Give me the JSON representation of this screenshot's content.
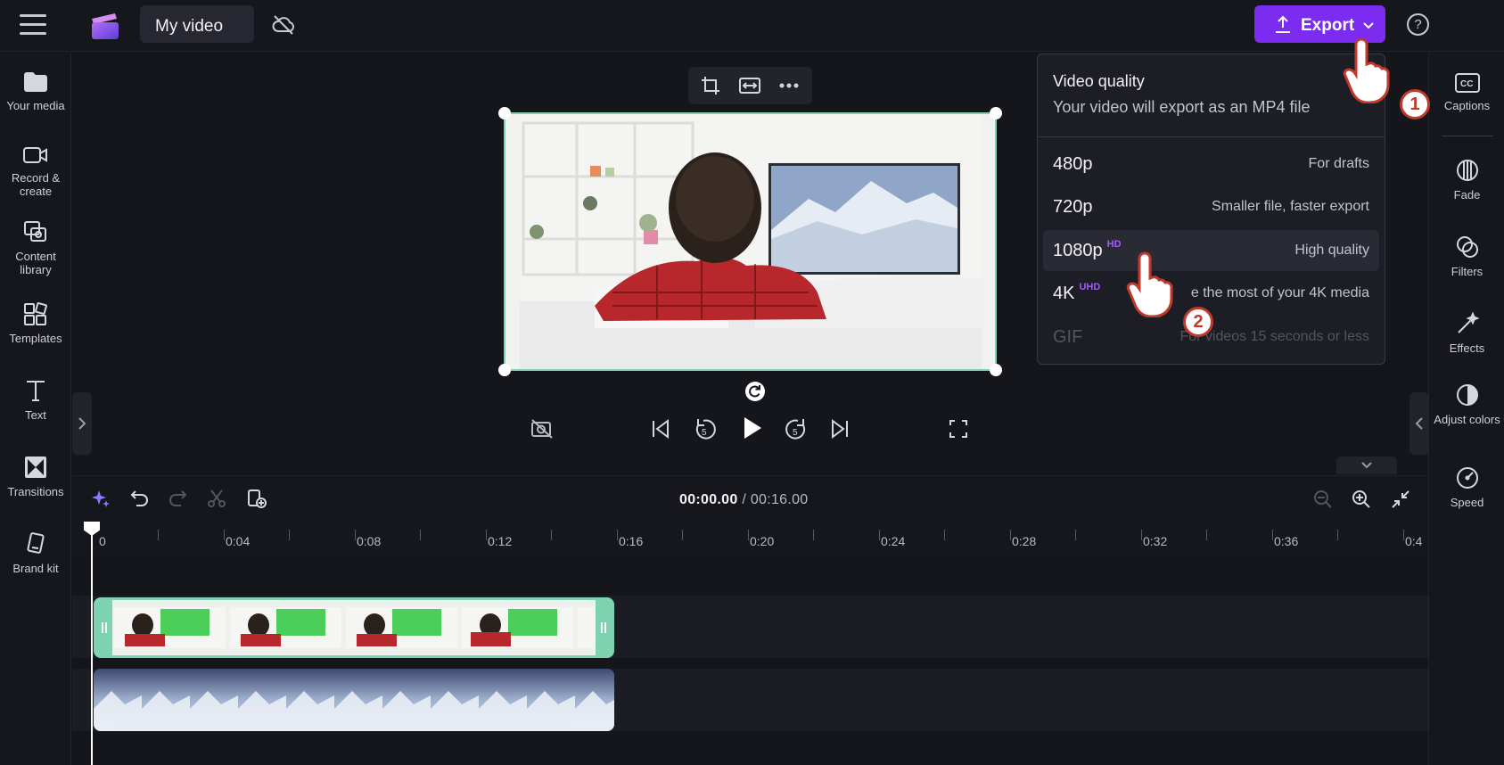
{
  "header": {
    "project_title": "My video",
    "export_label": "Export",
    "help_label": "?"
  },
  "left_sidebar": {
    "items": [
      {
        "label": "Your media",
        "icon": "folder-icon"
      },
      {
        "label": "Record & create",
        "icon": "camera-icon"
      },
      {
        "label": "Content library",
        "icon": "library-icon"
      },
      {
        "label": "Templates",
        "icon": "templates-icon"
      },
      {
        "label": "Text",
        "icon": "text-icon"
      },
      {
        "label": "Transitions",
        "icon": "transitions-icon"
      },
      {
        "label": "Brand kit",
        "icon": "brand-kit-icon"
      }
    ]
  },
  "right_sidebar": {
    "items": [
      {
        "label": "Captions",
        "icon": "cc-icon"
      },
      {
        "label": "Fade",
        "icon": "fade-icon"
      },
      {
        "label": "Filters",
        "icon": "filters-icon"
      },
      {
        "label": "Effects",
        "icon": "effects-icon"
      },
      {
        "label": "Adjust colors",
        "icon": "adjust-colors-icon"
      },
      {
        "label": "Speed",
        "icon": "speed-icon"
      }
    ]
  },
  "export_popup": {
    "title": "Video quality",
    "subtitle": "Your video will export as an MP4 file",
    "options": [
      {
        "quality": "480p",
        "tag": "",
        "desc": "For drafts"
      },
      {
        "quality": "720p",
        "tag": "",
        "desc": "Smaller file, faster export"
      },
      {
        "quality": "1080p",
        "tag": "HD",
        "desc": "High quality"
      },
      {
        "quality": "4K",
        "tag": "UHD",
        "desc": "e the most of your 4K media"
      },
      {
        "quality": "GIF",
        "tag": "",
        "desc": "For videos 15 seconds or less"
      }
    ],
    "highlighted": "1080p"
  },
  "timeline": {
    "current_time": "00:00.00",
    "separator": " / ",
    "total_time": "00:16.00",
    "ruler": [
      "0",
      "0:04",
      "0:08",
      "0:12",
      "0:16",
      "0:20",
      "0:24",
      "0:28",
      "0:32",
      "0:36",
      "0:4"
    ]
  },
  "annotations": {
    "step1": "1",
    "step2": "2"
  },
  "colors": {
    "accent": "#7b2cf0",
    "selection": "#7dd3b0",
    "tag": "#a25bff",
    "badge": "#c0392b"
  }
}
